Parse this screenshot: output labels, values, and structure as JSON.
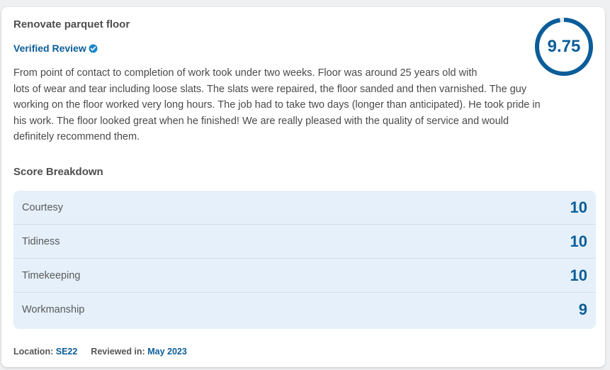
{
  "review": {
    "title": "Renovate parquet floor",
    "verified_label": "Verified Review",
    "score": "9.75",
    "score_fraction": 0.975,
    "body_lines": [
      "From point of contact to completion of work took under two weeks. Floor was around 25 years old with",
      "lots of wear and tear including loose slats. The slats were repaired, the floor sanded and then varnished. The guy",
      "working on the floor worked very long hours. The job had to take two days (longer than anticipated). He took pride in",
      "his work. The floor looked great when he finished! We are really pleased with the quality of service and would",
      "definitely recommend them."
    ]
  },
  "breakdown": {
    "title": "Score Breakdown",
    "rows": [
      {
        "label": "Courtesy",
        "value": "10"
      },
      {
        "label": "Tidiness",
        "value": "10"
      },
      {
        "label": "Timekeeping",
        "value": "10"
      },
      {
        "label": "Workmanship",
        "value": "9"
      }
    ]
  },
  "footer": {
    "location_label": "Location:",
    "location_value": "SE22",
    "reviewed_label": "Reviewed in:",
    "reviewed_value": "May 2023"
  },
  "colors": {
    "accent": "#0b5d99",
    "table_bg": "#e5f0fa"
  },
  "icons": {
    "verified": "check-badge-icon"
  }
}
